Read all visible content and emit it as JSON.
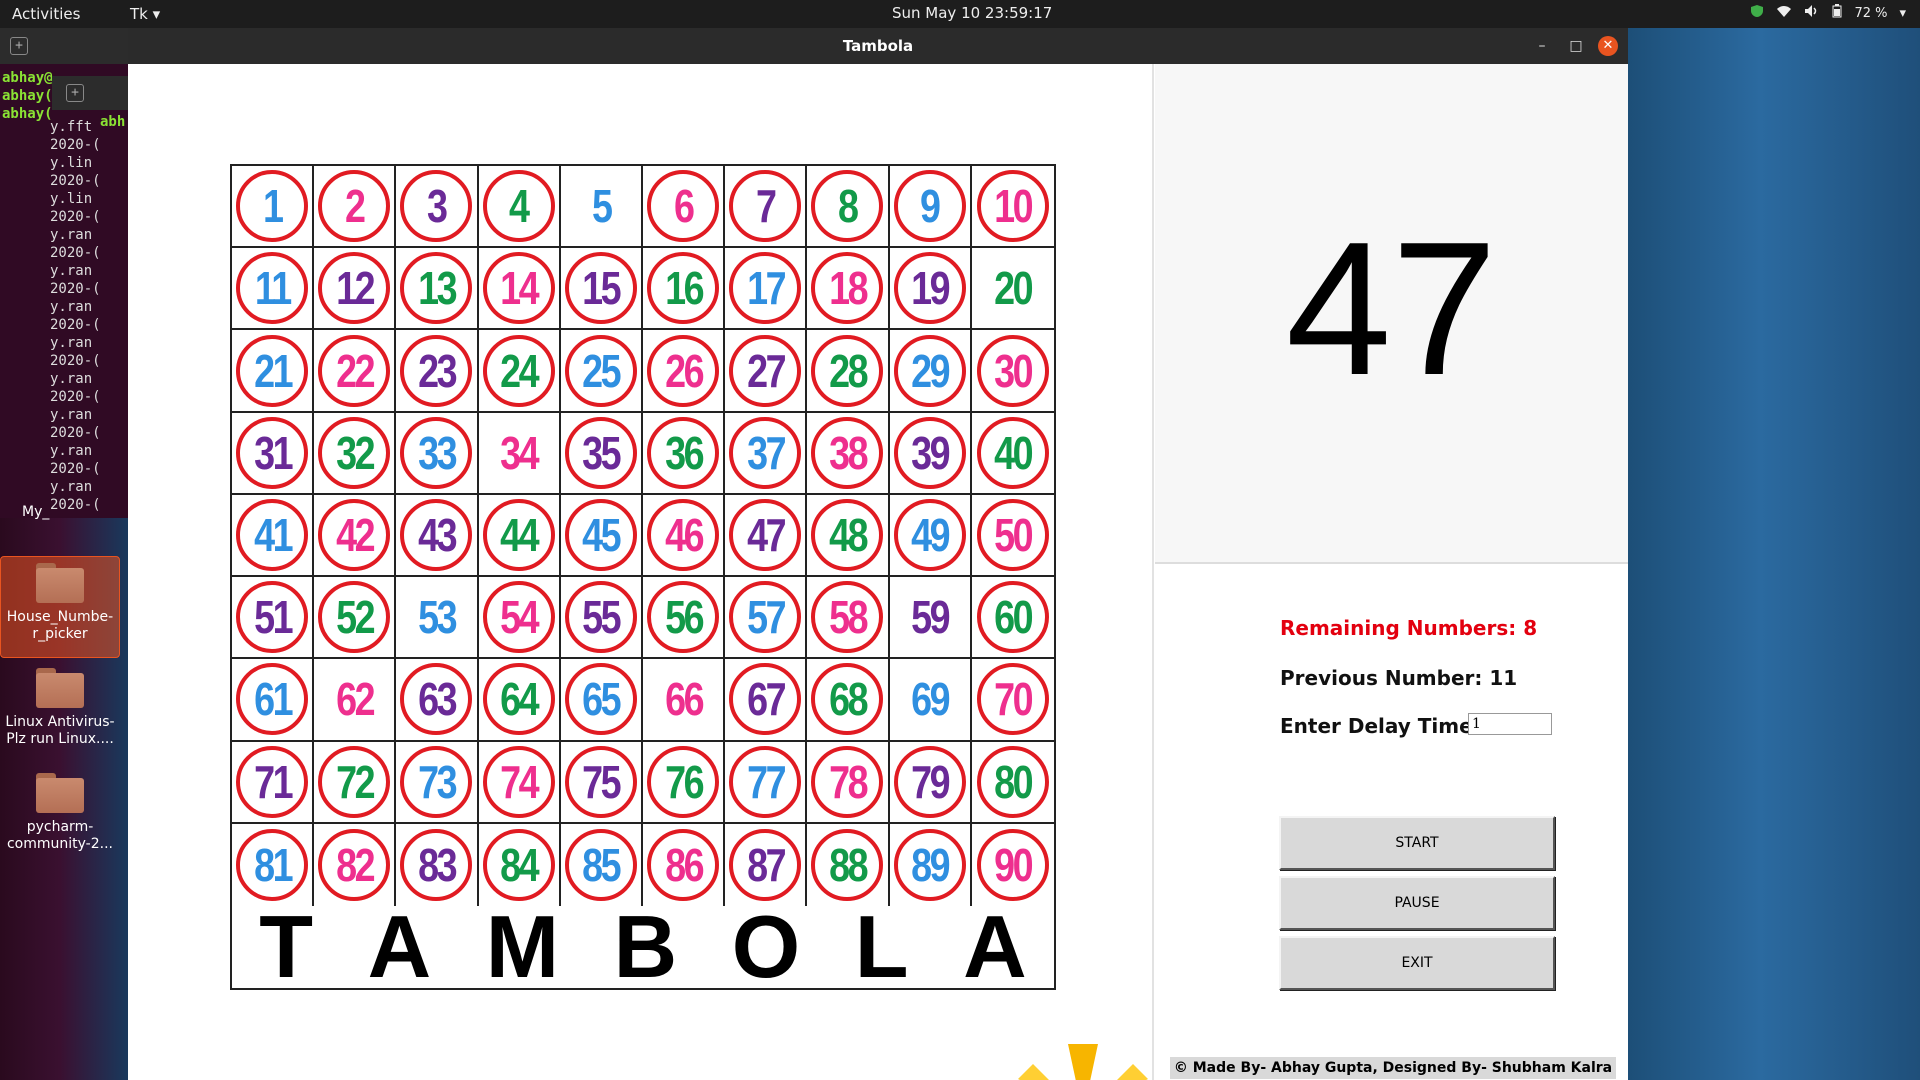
{
  "topbar": {
    "activities": "Activities",
    "app_menu": "Tk",
    "clock": "Sun May 10  23:59:17",
    "battery": "72 %"
  },
  "terminal": {
    "prompts": [
      "abhay@",
      "abhay(",
      "abhay("
    ],
    "lines": [
      "y.fft",
      "2020-(",
      "y.lin",
      "2020-(",
      "y.lin",
      "2020-(",
      "y.ran",
      "2020-(",
      "y.ran",
      "2020-(",
      "y.ran",
      "2020-(",
      "y.ran",
      "2020-(",
      "y.ran",
      "2020-(",
      "y.ran",
      "2020-(",
      "y.ran",
      "2020-(",
      "y.ran",
      "2020-(",
      "y.ran"
    ],
    "side_label": "abh",
    "bottom_label": "My_"
  },
  "desktop_icons": [
    {
      "label": "House_Numbe-r_picker",
      "selected": true
    },
    {
      "label": "Linux Antivirus-Plz run Linux....",
      "selected": false
    },
    {
      "label": "pycharm-community-2...",
      "selected": false
    }
  ],
  "window": {
    "title": "Tambola",
    "minimize": "–",
    "maximize": "□",
    "close": "✕"
  },
  "board": {
    "colors": {
      "blue": "#2f8fe0",
      "pink": "#ee2f8e",
      "purple": "#6a2a97",
      "green": "#129a49",
      "red": "#e11b22"
    },
    "cells": [
      [
        "blue",
        1
      ],
      [
        "pink",
        1
      ],
      [
        "purple",
        1
      ],
      [
        "green",
        1
      ],
      [
        "blue",
        0
      ],
      [
        "pink",
        1
      ],
      [
        "purple",
        1
      ],
      [
        "green",
        1
      ],
      [
        "blue",
        1
      ],
      [
        "pink",
        1
      ],
      [
        "blue",
        1
      ],
      [
        "purple",
        1
      ],
      [
        "green",
        1
      ],
      [
        "pink",
        1
      ],
      [
        "purple",
        1
      ],
      [
        "green",
        1
      ],
      [
        "blue",
        1
      ],
      [
        "pink",
        1
      ],
      [
        "purple",
        1
      ],
      [
        "green",
        0
      ],
      [
        "blue",
        1
      ],
      [
        "pink",
        1
      ],
      [
        "purple",
        1
      ],
      [
        "green",
        1
      ],
      [
        "blue",
        1
      ],
      [
        "pink",
        1
      ],
      [
        "purple",
        1
      ],
      [
        "green",
        1
      ],
      [
        "blue",
        1
      ],
      [
        "pink",
        1
      ],
      [
        "purple",
        1
      ],
      [
        "green",
        1
      ],
      [
        "blue",
        1
      ],
      [
        "pink",
        0
      ],
      [
        "purple",
        1
      ],
      [
        "green",
        1
      ],
      [
        "blue",
        1
      ],
      [
        "pink",
        1
      ],
      [
        "purple",
        1
      ],
      [
        "green",
        1
      ],
      [
        "blue",
        1
      ],
      [
        "pink",
        1
      ],
      [
        "purple",
        1
      ],
      [
        "green",
        1
      ],
      [
        "blue",
        1
      ],
      [
        "pink",
        1
      ],
      [
        "purple",
        1
      ],
      [
        "green",
        1
      ],
      [
        "blue",
        1
      ],
      [
        "pink",
        1
      ],
      [
        "purple",
        1
      ],
      [
        "green",
        1
      ],
      [
        "blue",
        0
      ],
      [
        "pink",
        1
      ],
      [
        "purple",
        1
      ],
      [
        "green",
        1
      ],
      [
        "blue",
        1
      ],
      [
        "pink",
        1
      ],
      [
        "purple",
        0
      ],
      [
        "green",
        1
      ],
      [
        "blue",
        1
      ],
      [
        "pink",
        0
      ],
      [
        "purple",
        1
      ],
      [
        "green",
        1
      ],
      [
        "blue",
        1
      ],
      [
        "pink",
        0
      ],
      [
        "purple",
        1
      ],
      [
        "green",
        1
      ],
      [
        "blue",
        0
      ],
      [
        "pink",
        1
      ],
      [
        "purple",
        1
      ],
      [
        "green",
        1
      ],
      [
        "blue",
        1
      ],
      [
        "pink",
        1
      ],
      [
        "purple",
        1
      ],
      [
        "green",
        1
      ],
      [
        "blue",
        1
      ],
      [
        "pink",
        1
      ],
      [
        "purple",
        1
      ],
      [
        "green",
        1
      ],
      [
        "blue",
        1
      ],
      [
        "pink",
        1
      ],
      [
        "purple",
        1
      ],
      [
        "green",
        1
      ],
      [
        "blue",
        1
      ],
      [
        "pink",
        1
      ],
      [
        "purple",
        1
      ],
      [
        "green",
        1
      ],
      [
        "blue",
        1
      ],
      [
        "pink",
        1
      ]
    ],
    "letters": [
      "T",
      "A",
      "M",
      "B",
      "O",
      "L",
      "A"
    ]
  },
  "panel": {
    "current_number": "47",
    "remaining": "Remaining Numbers: 8",
    "previous": "Previous Number: 11",
    "delay_label": "Enter Delay Time:",
    "delay_value": "1",
    "start": "START",
    "pause": "PAUSE",
    "exit": "EXIT",
    "credit": "© Made By- Abhay Gupta, Designed By- Shubham Kalra ©"
  }
}
